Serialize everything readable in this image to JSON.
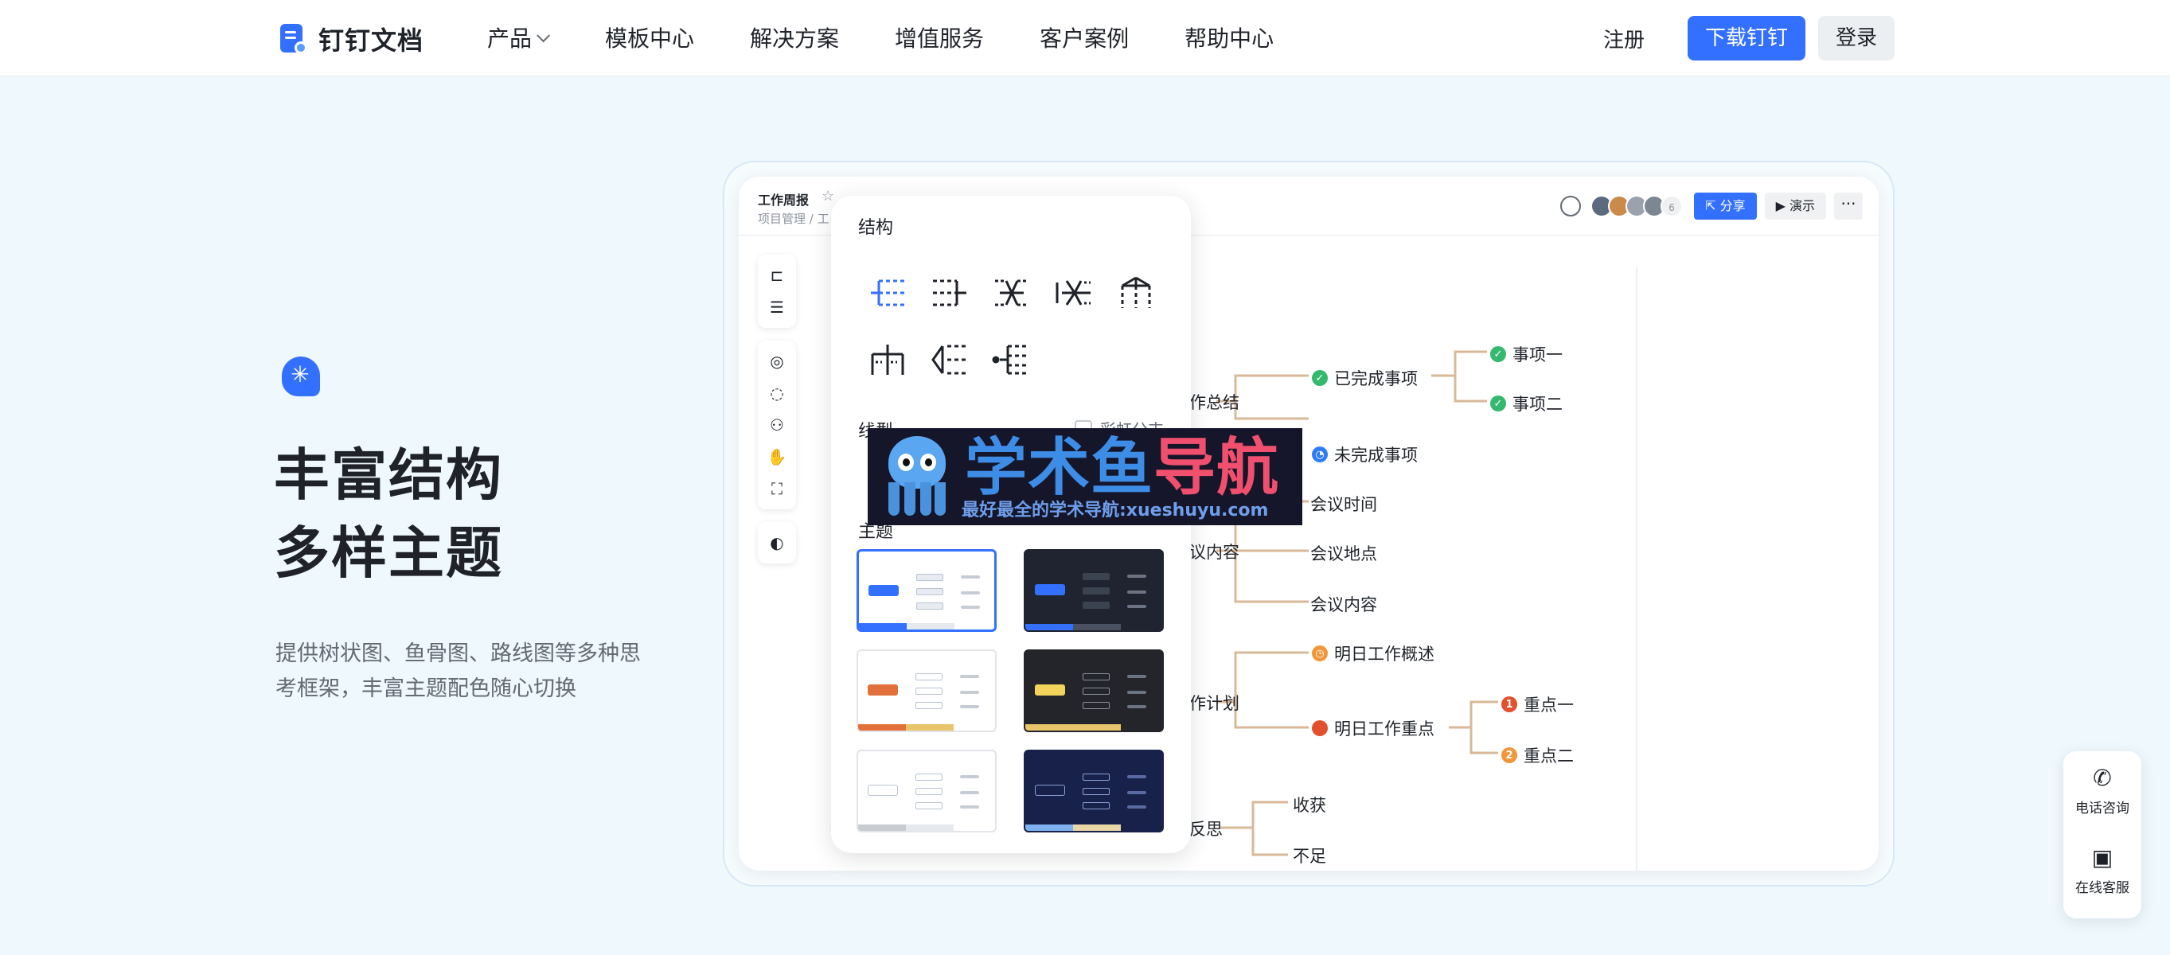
{
  "nav": {
    "logo_text": "钉钉文档",
    "menu": [
      {
        "label": "产品",
        "has_dropdown": true
      },
      {
        "label": "模板中心",
        "has_dropdown": false
      },
      {
        "label": "解决方案",
        "has_dropdown": false
      },
      {
        "label": "增值服务",
        "has_dropdown": false
      },
      {
        "label": "客户案例",
        "has_dropdown": false
      },
      {
        "label": "帮助中心",
        "has_dropdown": false
      }
    ],
    "register_label": "注册",
    "download_label": "下载钉钉",
    "login_label": "登录"
  },
  "hero": {
    "title_line1": "丰富结构",
    "title_line2": "多样主题",
    "description": "提供树状图、鱼骨图、路线图等多种思考框架，丰富主题配色随心切换"
  },
  "doc": {
    "title": "工作周报",
    "breadcrumb": "项目管理 / 工",
    "collaborator_count": "6",
    "share_label": "分享",
    "present_label": "演示",
    "more_label": "···"
  },
  "panel": {
    "structure_title": "结构",
    "line_title": "线型",
    "rainbow_label": "彩虹分支",
    "theme_title": "主题"
  },
  "mindmap": {
    "branch_summary": "作总结",
    "done": "已完成事项",
    "item1": "事项一",
    "item2": "事项二",
    "undone": "未完成事项",
    "meeting_time": "会议时间",
    "branch_meeting": "议内容",
    "meeting_place": "会议地点",
    "meeting_content": "会议内容",
    "branch_plan": "作计划",
    "plan_overview": "明日工作概述",
    "plan_key": "明日工作重点",
    "key1": "重点一",
    "key2": "重点二",
    "key1_num": "1",
    "key2_num": "2",
    "branch_reflect": "反思",
    "gain": "收获",
    "lack": "不足"
  },
  "watermark": {
    "title_a": "学术鱼",
    "title_b": "导航",
    "subtitle": "最好最全的学术导航:xueshuyu.com"
  },
  "contact": {
    "phone_label": "电话咨询",
    "service_label": "在线客服"
  },
  "colors": {
    "accent": "#3370ff",
    "page_bg": "#eef8fd",
    "branch_line": "#d8b99a"
  }
}
